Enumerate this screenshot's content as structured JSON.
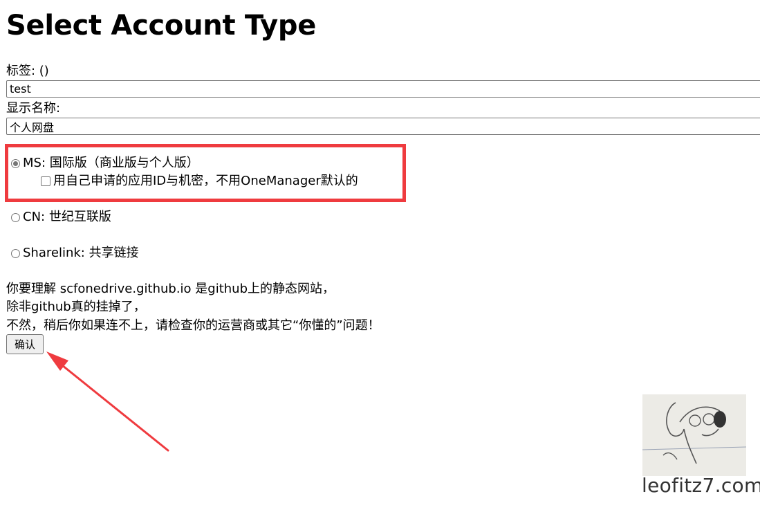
{
  "page": {
    "title": "Select Account Type"
  },
  "form": {
    "tag_label": "标签: ()",
    "tag_value": "test",
    "display_name_label": "显示名称:",
    "display_name_value": "个人网盘"
  },
  "options": {
    "ms_label": "MS: 国际版（商业版与个人版）",
    "ms_checked": true,
    "custom_app_label": "用自己申请的应用ID与机密，不用OneManager默认的",
    "custom_app_checked": false,
    "cn_label": "CN: 世纪互联版",
    "sharelink_label": "Sharelink: 共享链接"
  },
  "notice": {
    "line1": "你要理解 scfonedrive.github.io 是github上的静态网站，",
    "line2": "除非github真的挂掉了，",
    "line3": "不然，稍后你如果连不上，请检查你的运营商或其它“你懂的”问题！"
  },
  "actions": {
    "confirm_label": "确认"
  },
  "watermark": {
    "text": "leofitz7.com"
  },
  "colors": {
    "highlight": "#ef3b3f",
    "arrow": "#ef3b3f"
  }
}
